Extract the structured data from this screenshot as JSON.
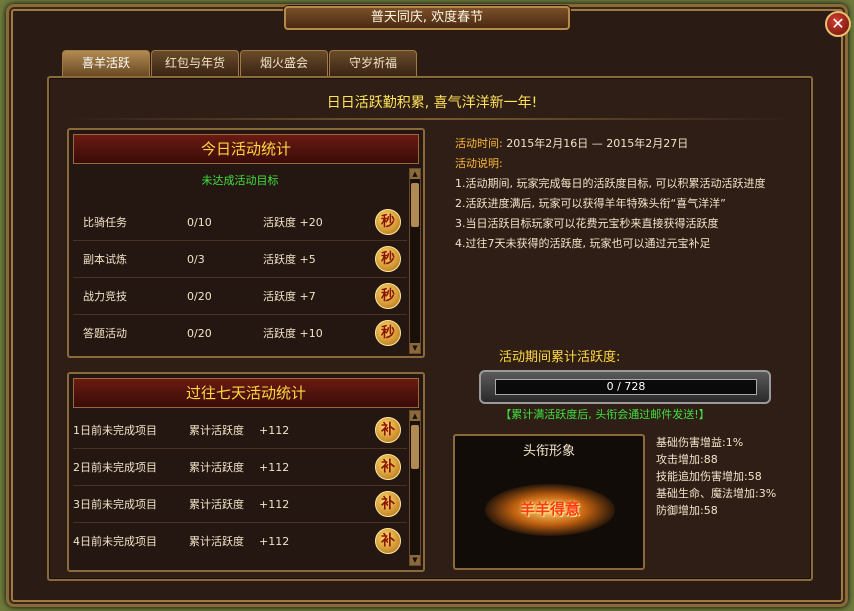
{
  "window": {
    "title": "普天同庆, 欢度春节",
    "close_label": "✕"
  },
  "tabs": [
    {
      "label": "喜羊活跃",
      "active": true
    },
    {
      "label": "红包与年货",
      "active": false
    },
    {
      "label": "烟火盛会",
      "active": false
    },
    {
      "label": "守岁祈福",
      "active": false
    }
  ],
  "headline": "日日活跃勤积累, 喜气洋洋新一年!",
  "today_panel": {
    "title": "今日活动统计",
    "status": "未达成活动目标",
    "rows": [
      {
        "name": "比骑任务",
        "progress": "0/10",
        "reward": "活跃度 +20",
        "action": "秒"
      },
      {
        "name": "副本试炼",
        "progress": "0/3",
        "reward": "活跃度 +5",
        "action": "秒"
      },
      {
        "name": "战力竞技",
        "progress": "0/20",
        "reward": "活跃度 +7",
        "action": "秒"
      },
      {
        "name": "答题活动",
        "progress": "0/20",
        "reward": "活跃度 +10",
        "action": "秒"
      }
    ]
  },
  "past_panel": {
    "title": "过往七天活动统计",
    "rows": [
      {
        "name": "1日前未完成项目",
        "label": "累计活跃度",
        "value": "+112",
        "action": "补"
      },
      {
        "name": "2日前未完成项目",
        "label": "累计活跃度",
        "value": "+112",
        "action": "补"
      },
      {
        "name": "3日前未完成项目",
        "label": "累计活跃度",
        "value": "+112",
        "action": "补"
      },
      {
        "name": "4日前未完成项目",
        "label": "累计活跃度",
        "value": "+112",
        "action": "补"
      }
    ]
  },
  "info": {
    "time_label": "活动时间:",
    "time_value": "2015年2月16日 — 2015年2月27日",
    "desc_label": "活动说明:",
    "lines": [
      "1.活动期间, 玩家完成每日的活跃度目标, 可以积累活动活跃进度",
      "2.活跃进度满后, 玩家可以获得羊年特殊头衔“喜气洋洋”",
      "3.当日活跃目标玩家可以花费元宝秒来直接获得活跃度",
      "4.过往7天未获得的活跃度, 玩家也可以通过元宝补足"
    ]
  },
  "progress": {
    "label": "活动期间累计活跃度:",
    "text": "0 / 728",
    "fraction": 0,
    "note": "【累计满活跃度后, 头衔会通过邮件发送!】"
  },
  "title_preview": {
    "header": "头衔形象",
    "badge_text": "羊羊得意"
  },
  "attributes": [
    "基础伤害增益:1%",
    "攻击增加:88",
    "技能追加伤害增加:58",
    "基础生命、魔法增加:3%",
    "防御增加:58"
  ]
}
